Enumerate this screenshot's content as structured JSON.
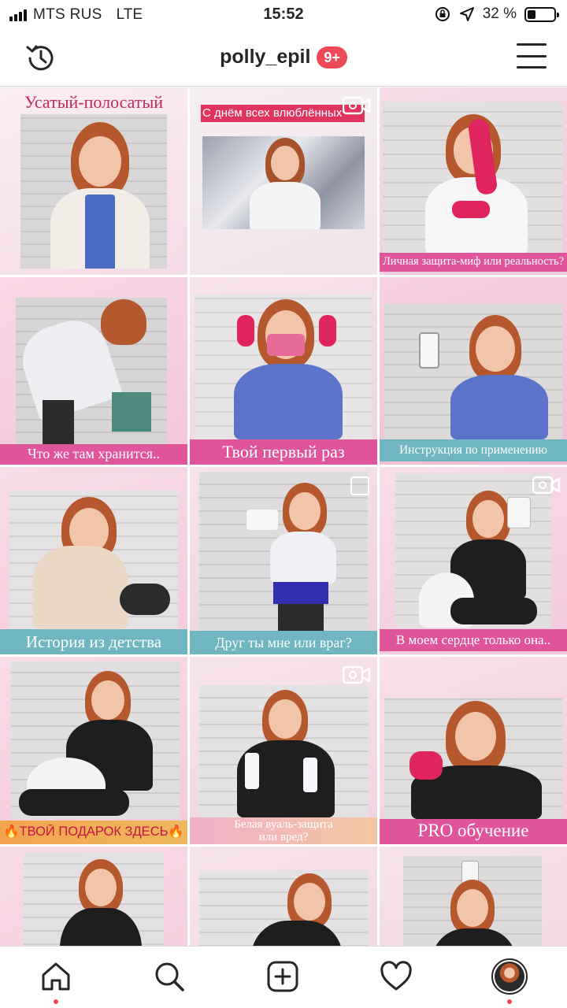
{
  "status_bar": {
    "carrier": "MTS RUS",
    "network": "LTE",
    "time": "15:52",
    "battery_percent": "32 %",
    "battery_level": 0.32
  },
  "header": {
    "username": "polly_epil",
    "notification_badge": "9+",
    "history_icon": "history-icon",
    "menu_icon": "hamburger-menu-icon"
  },
  "grid": {
    "posts": [
      {
        "caption": "Усатый-полосатый",
        "type": "photo"
      },
      {
        "caption": "С днём всех влюблённых",
        "type": "video"
      },
      {
        "caption": "Личная защита-миф или реальность?",
        "type": "photo"
      },
      {
        "caption": "Что же там хранится..",
        "type": "photo"
      },
      {
        "caption": "Твой первый раз",
        "type": "photo"
      },
      {
        "caption": "Инструкция по применению",
        "type": "photo"
      },
      {
        "caption": "История из детства",
        "type": "photo"
      },
      {
        "caption": "Друг ты мне или враг?",
        "type": "carousel"
      },
      {
        "caption": "В моем сердце только она..",
        "type": "video"
      },
      {
        "caption": "🔥ТВОЙ ПОДАРОК ЗДЕСЬ🔥",
        "type": "photo"
      },
      {
        "caption_line1": "Белая вуаль-защита",
        "caption_line2": "или вред?",
        "type": "video"
      },
      {
        "caption": "PRO обучение",
        "type": "photo"
      },
      {
        "caption": "",
        "type": "photo"
      },
      {
        "caption": "",
        "type": "photo"
      },
      {
        "caption": "",
        "type": "photo"
      }
    ]
  },
  "bottom_nav": {
    "items": [
      "home-icon",
      "search-icon",
      "new-post-icon",
      "activity-heart-icon",
      "profile-avatar"
    ]
  },
  "colors": {
    "badge": "#ed4956",
    "pink_banner": "#e0559a",
    "teal_banner": "#6fb6c0",
    "orange_banner": "#f0a35a",
    "tile_pink": "#f7d6e6"
  }
}
